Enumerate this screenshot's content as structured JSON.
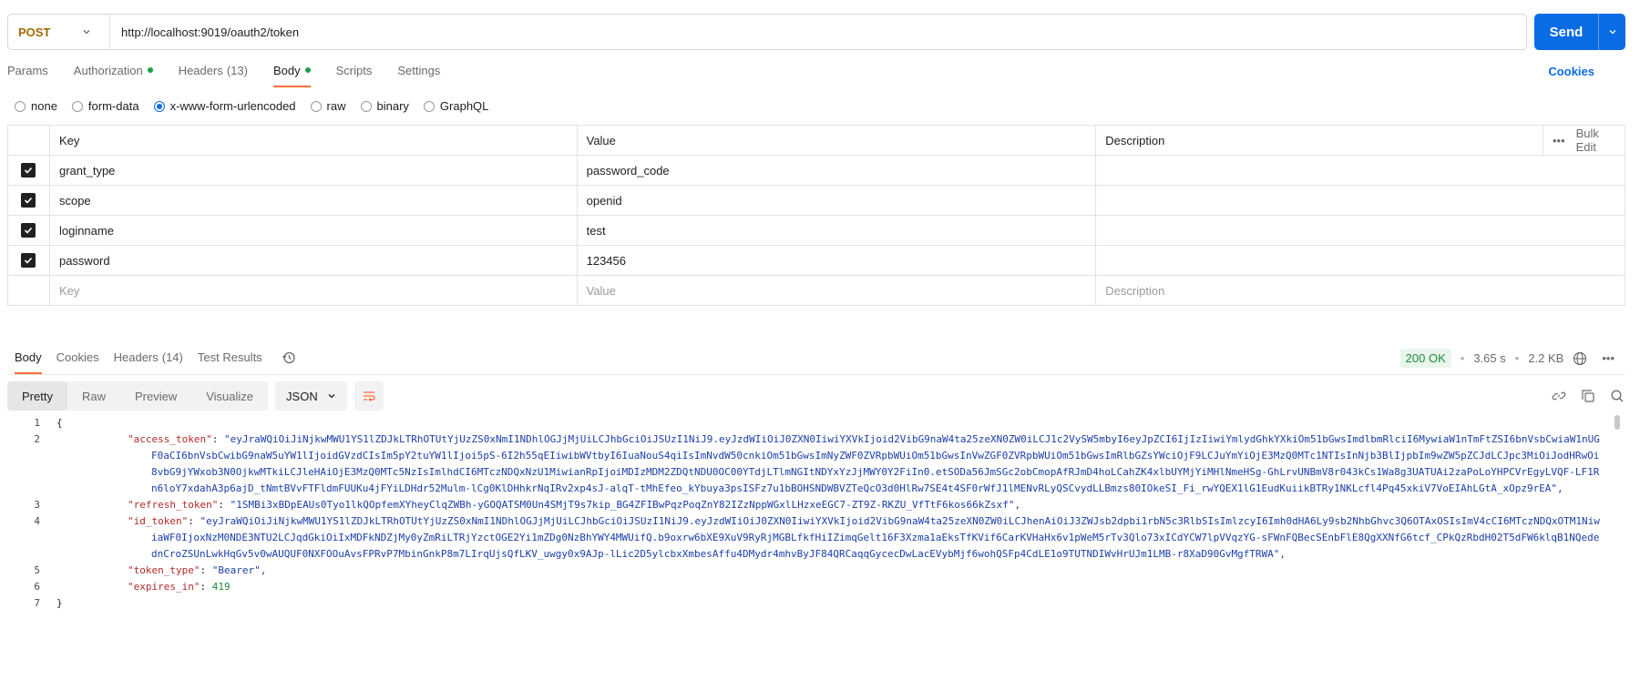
{
  "request": {
    "method": "POST",
    "url": "http://localhost:9019/oauth2/token",
    "send_label": "Send"
  },
  "req_tabs": {
    "params": "Params",
    "authorization": "Authorization",
    "headers": "Headers",
    "headers_count": "(13)",
    "body": "Body",
    "scripts": "Scripts",
    "settings": "Settings",
    "cookies": "Cookies"
  },
  "body_types": [
    "none",
    "form-data",
    "x-www-form-urlencoded",
    "raw",
    "binary",
    "GraphQL"
  ],
  "table": {
    "headers": {
      "key": "Key",
      "value": "Value",
      "description": "Description",
      "bulk_edit": "Bulk Edit"
    },
    "rows": [
      {
        "key": "grant_type",
        "value": "password_code"
      },
      {
        "key": "scope",
        "value": "openid"
      },
      {
        "key": "loginname",
        "value": "test"
      },
      {
        "key": "password",
        "value": "123456"
      }
    ],
    "placeholders": {
      "key": "Key",
      "value": "Value",
      "description": "Description"
    }
  },
  "response": {
    "tabs": {
      "body": "Body",
      "cookies": "Cookies",
      "headers": "Headers",
      "headers_count": "(14)",
      "test_results": "Test Results"
    },
    "status": "200 OK",
    "time": "3.65 s",
    "size": "2.2 KB",
    "views": [
      "Pretty",
      "Raw",
      "Preview",
      "Visualize"
    ],
    "format": "JSON"
  },
  "code": {
    "l1": "{",
    "access_token_key": "\"access_token\"",
    "access_token_val": "\"eyJraWQiOiJiNjkwMWU1YS1lZDJkLTRhOTUtYjUzZS0xNmI1NDhlOGJjMjUiLCJhbGciOiJSUzI1NiJ9.eyJzdWIiOiJ0ZXN0IiwiYXVkIjoid2VibG9naW4ta25zeXN0ZW0iLCJ1c2VySW5mbyI6eyJpZCI6IjIzIiwiYmlydGhkYXkiOm51bGwsImdlbmRlciI6MywiaW1nTmFtZSI6bnVsbCwiaW1nUGF0aCI6bnVsbCwibG9naW5uYW1lIjoidGVzdCIsIm5pY2tuYW1lIjoi5pS-6I2h55qEIiwibWVtbyI6IuaNouS4qiIsImNvdW50cnkiOm51bGwsImNyZWF0ZVRpbWUiOm51bGwsInVwZGF0ZVRpbWUiOm51bGwsImRlbGZsYWciOjF9LCJuYmYiOjE3MzQ0MTc1NTIsInNjb3BlIjpbIm9wZW5pZCJdLCJpc3MiOiJodHRwOi8vbG9jYWxob3N0OjkwMTkiLCJleHAiOjE3MzQ0MTc5NzIsImlhdCI6MTczNDQxNzU1MiwianRpIjoiMDIzMDM2ZDQtNDU0OC00YTdjLTlmNGItNDYxYzJjMWY0Y2FiIn0.etSODa56JmSGc2obCmopAfRJmD4hoLCahZK4xlbUYMjYiMHlNmeHSg-GhLrvUNBmV8r043kCs1Wa8g3UATUAi2zaPoLoYHPCVrEgyLVQF-LF1Rn6loY7xdahA3p6ajD_tNmtBVvFTFldmFUUKu4jFYiLDHdr52Mulm-lCg0KlDHhkrNqIRv2xp4sJ-alqT-tMhEfeo_kYbuya3psISFz7u1bBOHSNDWBVZTeQcO3d0HlRw7SE4t4SF0rWfJ1lMENvRLyQSCvydLLBmzs80IOkeSI_Fi_rwYQEX1lG1EudKuiikBTRy1NKLcfl4Pq45xkiV7VoEIAhLGtA_xOpz9rEA\",",
    "refresh_token_key": "\"refresh_token\"",
    "refresh_token_val": "\"1SMBi3xBDpEAUs0Tyo1lkQOpfemXYheyClqZWBh-yGOQATSM0Un4SMjT9s7kip_BG4ZFIBwPqzPoqZnY82IZzNppWGxlLHzxeEGC7-ZT9Z-RKZU_VfTtF6kos66kZsxf\",",
    "id_token_key": "\"id_token\"",
    "id_token_val": "\"eyJraWQiOiJiNjkwMWU1YS1lZDJkLTRhOTUtYjUzZS0xNmI1NDhlOGJjMjUiLCJhbGciOiJSUzI1NiJ9.eyJzdWIiOiJ0ZXN0IiwiYXVkIjoid2VibG9naW4ta25zeXN0ZW0iLCJhenAiOiJ3ZWJsb2dpbi1rbN5c3RlbSIsImlzcyI6Imh0dHA6Ly9sb2NhbGhvc3Q6OTAxOSIsImV4cCI6MTczNDQxOTM1NiwiaWF0IjoxNzM0NDE3NTU2LCJqdGkiOiIxMDFkNDZjMy0yZmRiLTRjYzctOGE2Yi1mZDg0NzBhYWY4MWUifQ.b9oxrw6bXE9XuV9RyRjMGBLfkfHiIZimqGelt16F3Xzma1aEksTfKVif6CarKVHaHx6v1pWeM5rTv3Qlo73xICdYCW7lpVVqzYG-sFWnFQBecSEnbFlE8QgXXNfG6tcf_CPkQzRbdH02T5dFW6klqB1NQedednCroZSUnLwkHqGv5v0wAUQUF0NXFOOuAvsFPRvP7MbinGnkP8m7LIrqUjsQfLKV_uwgy0x9AJp-lLic2D5ylcbxXmbesAffu4DMydr4mhvByJF84QRCaqqGycecDwLacEVybMjf6wohQSFp4CdLE1o9TUTNDIWvHrUJm1LMB-r8XaD90GvMgfTRWA\",",
    "token_type_key": "\"token_type\"",
    "token_type_val": "\"Bearer\",",
    "expires_in_key": "\"expires_in\"",
    "expires_in_val": "419",
    "l7": "}"
  },
  "colors": {
    "accent": "#ff6c37",
    "send": "#0a6ce4",
    "ok": "#1e8a3f"
  }
}
